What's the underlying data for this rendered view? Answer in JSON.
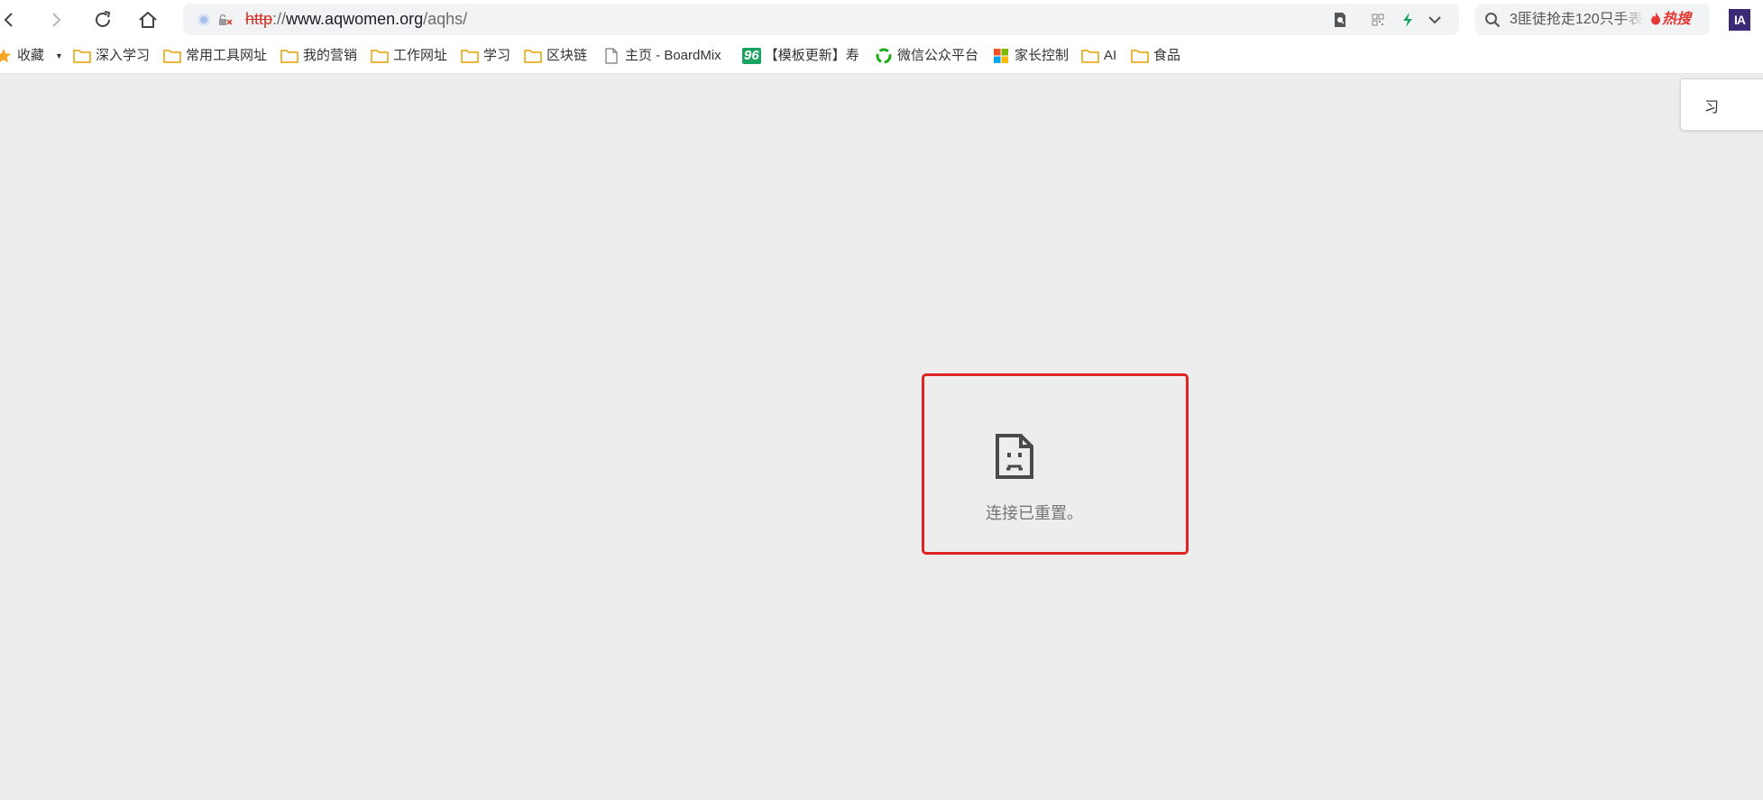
{
  "toolbar": {
    "address_bar": {
      "url_scheme": "http",
      "url_separator": "://",
      "url_host": "www.aqwomen.org",
      "url_path": "/aqhs/"
    },
    "search_box": {
      "query": "3匪徒抢走120只手表",
      "hot_label": "热搜"
    },
    "profile_label": "IA"
  },
  "bookmarks": {
    "favorites_label": "收藏",
    "items": [
      {
        "label": "深入学习",
        "icon": "folder-icon"
      },
      {
        "label": "常用工具网址",
        "icon": "folder-icon"
      },
      {
        "label": "我的营销",
        "icon": "folder-icon"
      },
      {
        "label": "工作网址",
        "icon": "folder-icon"
      },
      {
        "label": "学习",
        "icon": "folder-icon"
      },
      {
        "label": "区块链",
        "icon": "folder-icon"
      },
      {
        "label": "主页 - BoardMix",
        "icon": "page-icon"
      },
      {
        "label": "【模板更新】寿",
        "icon": "badge-96",
        "badge": "96"
      },
      {
        "label": "微信公众平台",
        "icon": "wechat-icon"
      },
      {
        "label": "家长控制",
        "icon": "microsoft-icon"
      },
      {
        "label": "AI",
        "icon": "folder-icon"
      },
      {
        "label": "食品",
        "icon": "folder-icon"
      }
    ]
  },
  "side_panel": {
    "tab_label": "习"
  },
  "error_page": {
    "message": "连接已重置。"
  },
  "colors": {
    "highlight_border": "#e02323",
    "page_background": "#ededed",
    "folder": "#f5b400",
    "hot": "#e53935"
  }
}
